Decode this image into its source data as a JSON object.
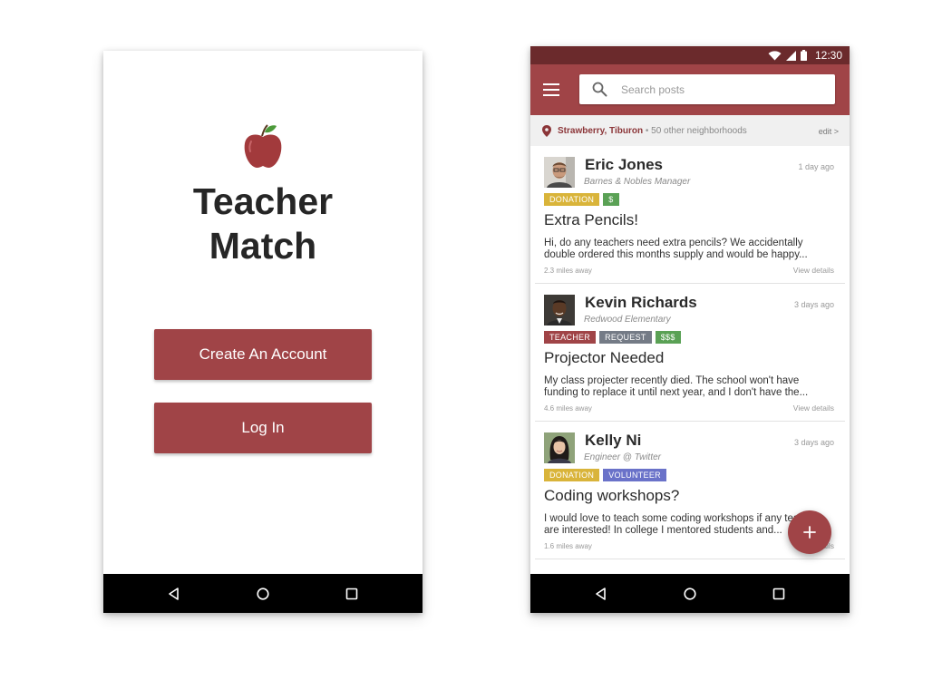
{
  "login_screen": {
    "title_line1": "Teacher",
    "title_line2": "Match",
    "create_account_label": "Create An Account",
    "login_label": "Log In",
    "logo_icon": "apple-icon"
  },
  "feed_screen": {
    "status_bar": {
      "time": "12:30",
      "icons": [
        "wifi-icon",
        "signal-icon",
        "battery-icon"
      ]
    },
    "search": {
      "placeholder": "Search posts"
    },
    "location": {
      "primary": "Strawberry, Tiburon",
      "separator": " • ",
      "secondary": "50 other neighborhoods",
      "edit_label": "edit >"
    },
    "posts": [
      {
        "author": "Eric Jones",
        "affiliation": "Barnes & Nobles Manager",
        "time": "1 day ago",
        "tags": [
          {
            "label": "DONATION",
            "color": "#d9b43a"
          },
          {
            "label": "$",
            "color": "#5aa155"
          }
        ],
        "title": "Extra Pencils!",
        "body": "Hi, do any teachers need extra pencils? We accidentally double ordered this months supply and would be happy...",
        "distance": "2.3 miles away",
        "details_label": "View details"
      },
      {
        "author": "Kevin Richards",
        "affiliation": "Redwood Elementary",
        "time": "3 days ago",
        "tags": [
          {
            "label": "TEACHER",
            "color": "#a04447"
          },
          {
            "label": "REQUEST",
            "color": "#747b86"
          },
          {
            "label": "$$$",
            "color": "#5aa155"
          }
        ],
        "title": "Projector Needed",
        "body": "My class projecter recently died. The school won't have funding to replace it until next year, and I don't have the...",
        "distance": "4.6 miles away",
        "details_label": "View details"
      },
      {
        "author": "Kelly Ni",
        "affiliation": "Engineer @ Twitter",
        "time": "3 days ago",
        "tags": [
          {
            "label": "DONATION",
            "color": "#d9b43a"
          },
          {
            "label": "VOLUNTEER",
            "color": "#6a72c9"
          }
        ],
        "title": "Coding workshops?",
        "body": "I would love to teach some coding workshops if any teachers are interested! In college I mentored students and...",
        "distance": "1.6 miles away",
        "details_label": "View details"
      }
    ],
    "fab_label": "+"
  },
  "colors": {
    "brand": "#a04447",
    "status_bar": "#6b2a2c",
    "nav_bar": "#000000"
  }
}
